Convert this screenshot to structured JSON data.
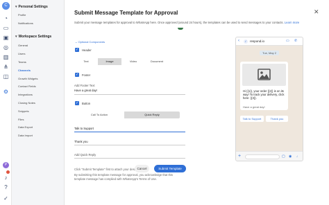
{
  "rail": {
    "logo_letter": "C",
    "avatar_letter": "P",
    "icons": [
      "logo-icon",
      "gauge-icon",
      "inbox-icon",
      "contacts-icon",
      "broadcast-icon",
      "reports-icon",
      "workflow-icon",
      "integrations-icon",
      "settings-icon",
      "avatar",
      "notifications-icon",
      "help-icon",
      "brand-icon"
    ]
  },
  "nav": {
    "personal_title": "Personal Settings",
    "personal_items": [
      "Profile",
      "Notifications"
    ],
    "workspace_title": "Workspace Settings",
    "workspace_items": [
      "General",
      "Users",
      "Teams",
      "Channels",
      "Growth Widgets",
      "Contact Fields",
      "Integrations",
      "Closing Notes",
      "Snippets",
      "Files",
      "Data Export",
      "Data Import"
    ],
    "active": "Channels"
  },
  "modal": {
    "title": "Submit Message Template for Approval",
    "description": "Submit your message templates for approval to WhatsApp here. Once approved (around 24 hours), the templates can be used to send messages to your contacts.",
    "learn_more": "Learn more",
    "optional_components": "Optional Components",
    "header_label": "Header",
    "header_tabs": [
      "Text",
      "Image",
      "Video",
      "Document"
    ],
    "header_selected": "Image",
    "footer_label": "Footer",
    "add_footer_text": "Add Footer Text",
    "footer_value": "Have a great day!",
    "button_label": "Button",
    "button_tabs": [
      "Call To Action",
      "Quick Reply"
    ],
    "button_selected": "Quick Reply",
    "quick_reply_1": "Talk to Support",
    "quick_reply_2": "Thank you",
    "add_quick_reply": "Add Quick Reply",
    "note_1": "Click \"Submit Template\" first to attach your desired file.",
    "note_2": "By submitting this template message for approval, you acknowledge that this template message has complied with WhatsApp's Terms of Use.",
    "cancel": "Cancel",
    "submit": "Submit Template",
    "close_icon": "close-icon"
  },
  "preview": {
    "contact_name": "respond.io",
    "date_chip": "Tue, May 2",
    "message": "Hi {{1}}, your order {{2}} is on its way! To track your delivery, click here: {{3}}.",
    "footer": "Have a great day!",
    "quick_replies": [
      "Talk to Support",
      "Thank you"
    ]
  },
  "colors": {
    "accent": "#2f6fd6",
    "chat_bg": "#efe7dd",
    "sidebar_bg": "#f4f5f7"
  }
}
